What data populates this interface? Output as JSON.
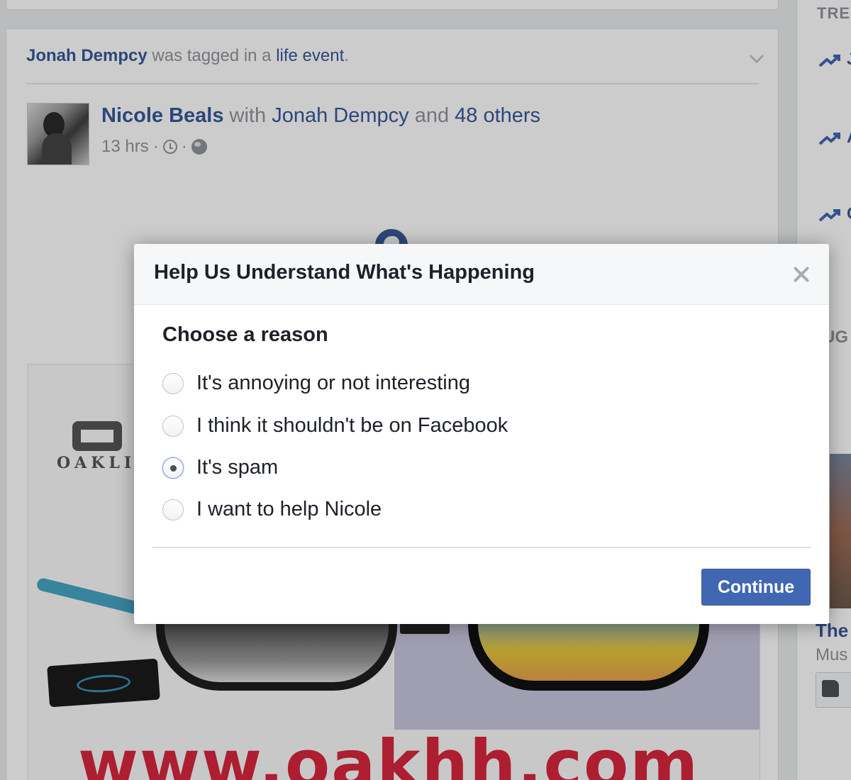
{
  "feed": {
    "story_header": {
      "actor": "Jonah Dempcy",
      "verb": "was tagged in a",
      "object": "life event",
      "period": "."
    },
    "post": {
      "author": "Nicole Beals",
      "with_text": "with",
      "tagged": "Jonah Dempcy",
      "and_text": "and",
      "others": "48 others",
      "time": "13 hrs",
      "dot1": "·",
      "dot2": "·"
    },
    "ad": {
      "brand_text": "OAKLI",
      "url_text": "www.oakhh.com"
    }
  },
  "right_column": {
    "trending_header": "TRE",
    "trend_items": [
      "J",
      "A",
      "C"
    ],
    "suggested_header": "UG",
    "page_title": "The",
    "page_category": "Mus"
  },
  "dialog": {
    "title": "Help Us Understand What's Happening",
    "subtitle": "Choose a reason",
    "options": [
      {
        "label": "It's annoying or not interesting",
        "selected": false
      },
      {
        "label": "I think it shouldn't be on Facebook",
        "selected": false
      },
      {
        "label": "It's spam",
        "selected": true
      },
      {
        "label": "I want to help Nicole",
        "selected": false
      }
    ],
    "continue_label": "Continue"
  },
  "colors": {
    "link": "#365899",
    "primary_button": "#4267b2",
    "ad_url": "#d7263d"
  },
  "icons": [
    "close-icon",
    "clock-icon",
    "world-icon",
    "globe-icon",
    "chevron-down-icon",
    "trending-arrow-icon",
    "like-icon"
  ]
}
